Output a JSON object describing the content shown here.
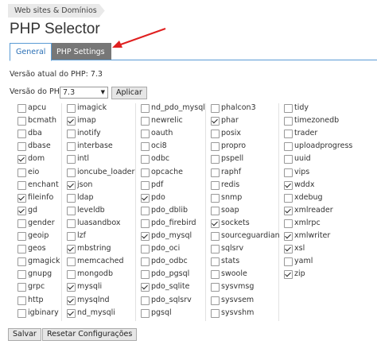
{
  "breadcrumb": "Web sites & Domínios",
  "title": "PHP Selector",
  "tabs": {
    "general": "General",
    "php_settings": "PHP Settings"
  },
  "current_version": "Versão atual do PHP: 7.3",
  "selector": {
    "label": "Versão do PHP:",
    "value": "7.3",
    "apply": "Aplicar"
  },
  "footer": {
    "save": "Salvar",
    "reset": "Resetar Configurações"
  },
  "extension_columns": [
    [
      {
        "name": "apcu",
        "checked": false
      },
      {
        "name": "bcmath",
        "checked": false
      },
      {
        "name": "dba",
        "checked": false
      },
      {
        "name": "dbase",
        "checked": false
      },
      {
        "name": "dom",
        "checked": true
      },
      {
        "name": "eio",
        "checked": false
      },
      {
        "name": "enchant",
        "checked": false
      },
      {
        "name": "fileinfo",
        "checked": true
      },
      {
        "name": "gd",
        "checked": true
      },
      {
        "name": "gender",
        "checked": false
      },
      {
        "name": "geoip",
        "checked": false
      },
      {
        "name": "geos",
        "checked": false
      },
      {
        "name": "gmagick",
        "checked": false
      },
      {
        "name": "gnupg",
        "checked": false
      },
      {
        "name": "grpc",
        "checked": false
      },
      {
        "name": "http",
        "checked": false
      },
      {
        "name": "igbinary",
        "checked": false
      }
    ],
    [
      {
        "name": "imagick",
        "checked": false
      },
      {
        "name": "imap",
        "checked": true
      },
      {
        "name": "inotify",
        "checked": false
      },
      {
        "name": "interbase",
        "checked": false
      },
      {
        "name": "intl",
        "checked": false
      },
      {
        "name": "ioncube_loader",
        "checked": false
      },
      {
        "name": "json",
        "checked": true
      },
      {
        "name": "ldap",
        "checked": false
      },
      {
        "name": "leveldb",
        "checked": false
      },
      {
        "name": "luasandbox",
        "checked": false
      },
      {
        "name": "lzf",
        "checked": false
      },
      {
        "name": "mbstring",
        "checked": true
      },
      {
        "name": "memcached",
        "checked": false
      },
      {
        "name": "mongodb",
        "checked": false
      },
      {
        "name": "mysqli",
        "checked": true
      },
      {
        "name": "mysqlnd",
        "checked": true
      },
      {
        "name": "nd_mysqli",
        "checked": true
      }
    ],
    [
      {
        "name": "nd_pdo_mysql",
        "checked": false
      },
      {
        "name": "newrelic",
        "checked": false
      },
      {
        "name": "oauth",
        "checked": false
      },
      {
        "name": "oci8",
        "checked": false
      },
      {
        "name": "odbc",
        "checked": false
      },
      {
        "name": "opcache",
        "checked": false
      },
      {
        "name": "pdf",
        "checked": false
      },
      {
        "name": "pdo",
        "checked": true
      },
      {
        "name": "pdo_dblib",
        "checked": false
      },
      {
        "name": "pdo_firebird",
        "checked": false
      },
      {
        "name": "pdo_mysql",
        "checked": true
      },
      {
        "name": "pdo_oci",
        "checked": false
      },
      {
        "name": "pdo_odbc",
        "checked": false
      },
      {
        "name": "pdo_pgsql",
        "checked": false
      },
      {
        "name": "pdo_sqlite",
        "checked": true
      },
      {
        "name": "pdo_sqlsrv",
        "checked": false
      },
      {
        "name": "pgsql",
        "checked": false
      }
    ],
    [
      {
        "name": "phalcon3",
        "checked": false
      },
      {
        "name": "phar",
        "checked": true
      },
      {
        "name": "posix",
        "checked": false
      },
      {
        "name": "propro",
        "checked": false
      },
      {
        "name": "pspell",
        "checked": false
      },
      {
        "name": "raphf",
        "checked": false
      },
      {
        "name": "redis",
        "checked": false
      },
      {
        "name": "snmp",
        "checked": false
      },
      {
        "name": "soap",
        "checked": false
      },
      {
        "name": "sockets",
        "checked": true
      },
      {
        "name": "sourceguardian",
        "checked": false
      },
      {
        "name": "sqlsrv",
        "checked": false
      },
      {
        "name": "stats",
        "checked": false
      },
      {
        "name": "swoole",
        "checked": false
      },
      {
        "name": "sysvmsg",
        "checked": false
      },
      {
        "name": "sysvsem",
        "checked": false
      },
      {
        "name": "sysvshm",
        "checked": false
      }
    ],
    [
      {
        "name": "tidy",
        "checked": false
      },
      {
        "name": "timezonedb",
        "checked": false
      },
      {
        "name": "trader",
        "checked": false
      },
      {
        "name": "uploadprogress",
        "checked": false
      },
      {
        "name": "uuid",
        "checked": false
      },
      {
        "name": "vips",
        "checked": false
      },
      {
        "name": "wddx",
        "checked": true
      },
      {
        "name": "xdebug",
        "checked": false
      },
      {
        "name": "xmlreader",
        "checked": true
      },
      {
        "name": "xmlrpc",
        "checked": false
      },
      {
        "name": "xmlwriter",
        "checked": true
      },
      {
        "name": "xsl",
        "checked": true
      },
      {
        "name": "yaml",
        "checked": false
      },
      {
        "name": "zip",
        "checked": true
      }
    ]
  ],
  "colors": {
    "tab_accent": "#2a6fb5",
    "tab_inactive": "#777777",
    "annotation_arrow": "#e02020"
  }
}
